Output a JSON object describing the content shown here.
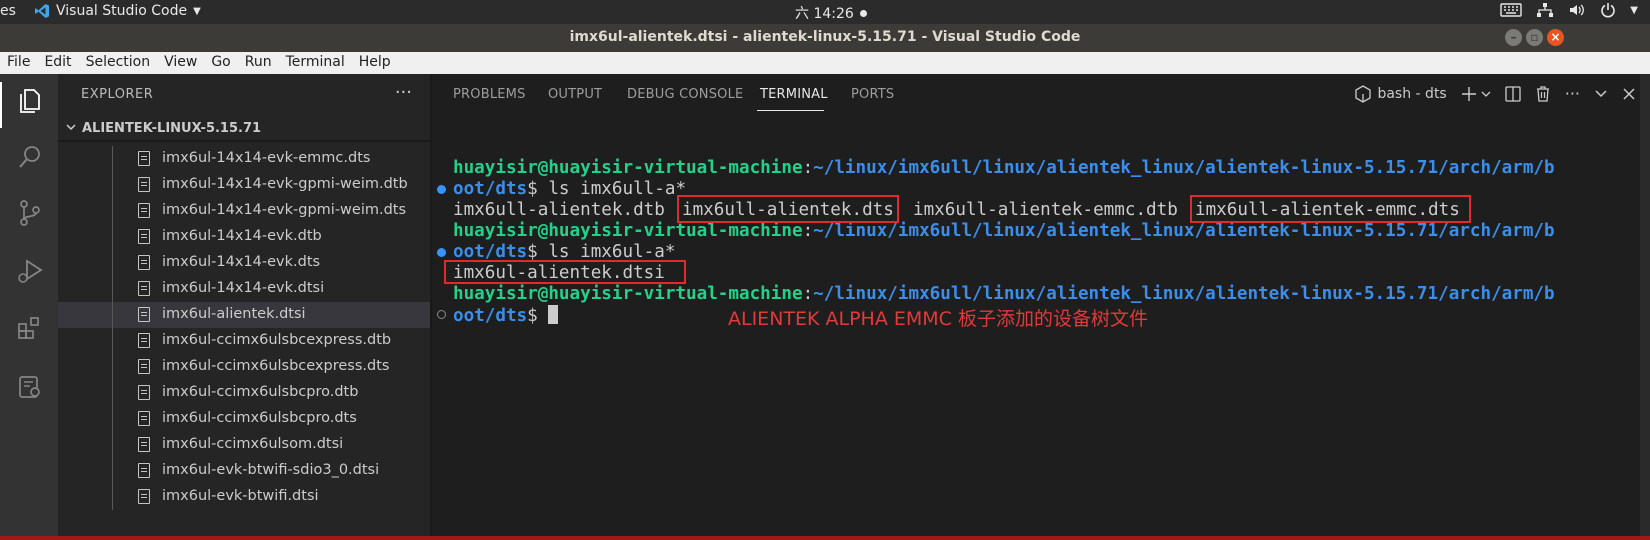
{
  "topbar": {
    "activities": "es",
    "app_name": "Visual Studio Code",
    "clock": "六 14:26"
  },
  "window": {
    "title": "imx6ul-alientek.dtsi - alientek-linux-5.15.71 - Visual Studio Code"
  },
  "menu": [
    "File",
    "Edit",
    "Selection",
    "View",
    "Go",
    "Run",
    "Terminal",
    "Help"
  ],
  "sidebar": {
    "header": "EXPLORER",
    "more": "···",
    "folder": "ALIENTEK-LINUX-5.15.71",
    "files": [
      {
        "name": "imx6ul-14x14-evk-emmc.dts"
      },
      {
        "name": "imx6ul-14x14-evk-gpmi-weim.dtb"
      },
      {
        "name": "imx6ul-14x14-evk-gpmi-weim.dts"
      },
      {
        "name": "imx6ul-14x14-evk.dtb"
      },
      {
        "name": "imx6ul-14x14-evk.dts"
      },
      {
        "name": "imx6ul-14x14-evk.dtsi"
      },
      {
        "name": "imx6ul-alientek.dtsi",
        "selected": true
      },
      {
        "name": "imx6ul-ccimx6ulsbcexpress.dtb"
      },
      {
        "name": "imx6ul-ccimx6ulsbcexpress.dts"
      },
      {
        "name": "imx6ul-ccimx6ulsbcpro.dtb"
      },
      {
        "name": "imx6ul-ccimx6ulsbcpro.dts"
      },
      {
        "name": "imx6ul-ccimx6ulsom.dtsi"
      },
      {
        "name": "imx6ul-evk-btwifi-sdio3_0.dtsi"
      },
      {
        "name": "imx6ul-evk-btwifi.dtsi"
      }
    ]
  },
  "panel": {
    "tabs": [
      "PROBLEMS",
      "OUTPUT",
      "DEBUG CONSOLE",
      "TERMINAL",
      "PORTS"
    ],
    "active_tab": "TERMINAL",
    "terminal_name": "bash - dts"
  },
  "terminal": {
    "user_host": "huayisir@huayisir-virtual-machine",
    "colon": ":",
    "path_line1": "~/linux/imx6ull/linux/alientek_linux/alientek-linux-5.15.71/arch/arm/b",
    "path_line2": "oot/dts",
    "prompt": "$ ",
    "cmd1": "ls imx6ull-a*",
    "out1": [
      "imx6ull-alientek.dtb",
      "imx6ull-alientek.dts",
      "imx6ull-alientek-emmc.dtb",
      "imx6ull-alientek-emmc.dts"
    ],
    "cmd2": "ls imx6ul-a*",
    "out2": "imx6ul-alientek.dtsi"
  },
  "annotation": "ALIENTEK ALPHA EMMC 板子添加的设备树文件",
  "colors": {
    "annotation_red": "#e22a2a",
    "prompt_green": "#23d18b",
    "path_blue": "#3b8eea"
  }
}
